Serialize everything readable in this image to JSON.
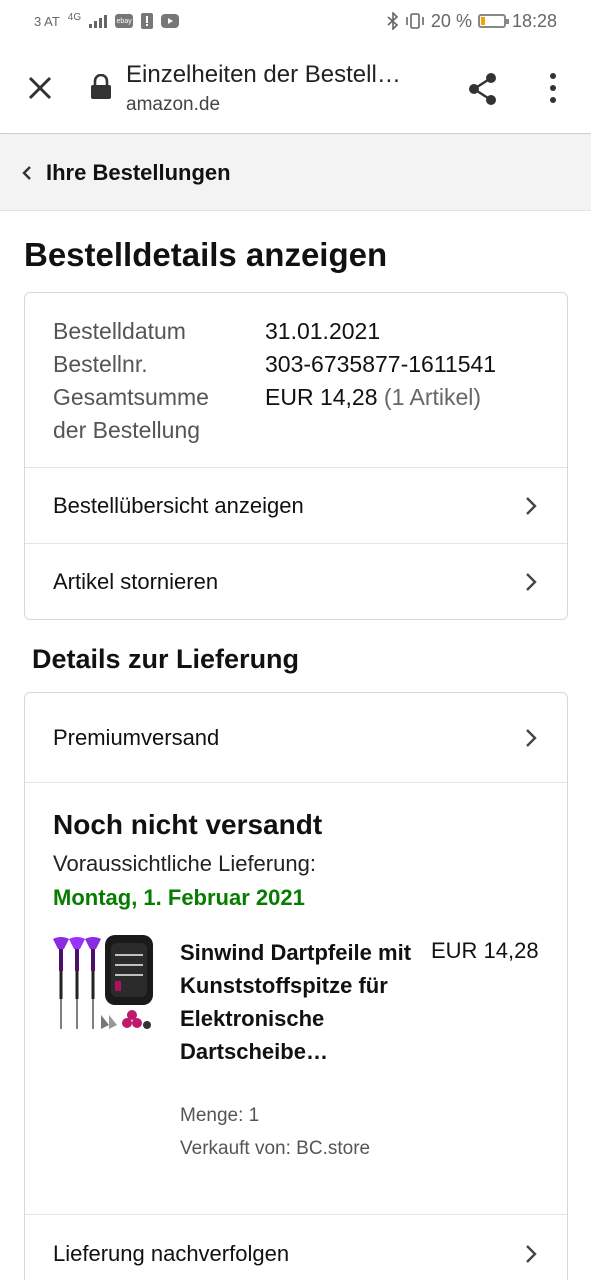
{
  "status_bar": {
    "carrier": "3 AT",
    "network": "4G",
    "app_badge": "ebay",
    "battery_percent": "20 %",
    "battery_level": 0.2,
    "time": "18:28"
  },
  "browser": {
    "page_title": "Einzelheiten der Bestell…",
    "domain": "amazon.de"
  },
  "breadcrumb": {
    "label": "Ihre Bestellungen"
  },
  "page": {
    "title": "Bestelldetails anzeigen"
  },
  "order": {
    "date_label": "Bestelldatum",
    "date_value": "31.01.2021",
    "number_label": "Bestellnr.",
    "number_value": "303-6735877-1611541",
    "total_label_1": "Gesamtsumme",
    "total_label_2": "der Bestellung",
    "total_value": "EUR 14,28",
    "total_items": "(1 Artikel)",
    "summary_link": "Bestellübersicht anzeigen",
    "cancel_link": "Artikel stornieren"
  },
  "delivery": {
    "section_title": "Details zur Lieferung",
    "shipping_method": "Premiumversand",
    "status": "Noch nicht versandt",
    "eta_label": "Voraussichtliche Lieferung:",
    "eta_date": "Montag, 1. Februar 2021",
    "track_link": "Lieferung nachverfolgen"
  },
  "product": {
    "title": "Sinwind Dartpfeile mit Kunststoffspitze für Elektronische Dartscheibe…",
    "price": "EUR 14,28",
    "quantity": "Menge: 1",
    "seller": "Verkauft von: BC.store"
  },
  "colors": {
    "eta_green": "#067d00",
    "breadcrumb_bg": "#f3f3f3",
    "card_border": "#d5d9d9"
  }
}
